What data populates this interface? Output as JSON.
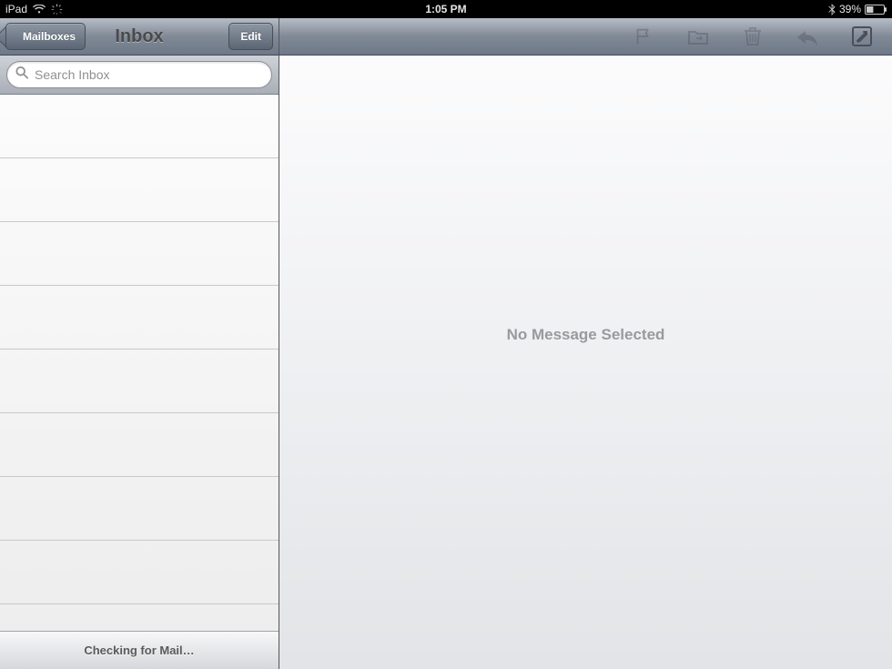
{
  "status": {
    "device": "iPad",
    "time": "1:05 PM",
    "battery_pct": "39%"
  },
  "sidebar": {
    "back_label": "Mailboxes",
    "title": "Inbox",
    "edit_label": "Edit",
    "search_placeholder": "Search Inbox",
    "status_text": "Checking for Mail…"
  },
  "main": {
    "empty_text": "No Message Selected"
  }
}
